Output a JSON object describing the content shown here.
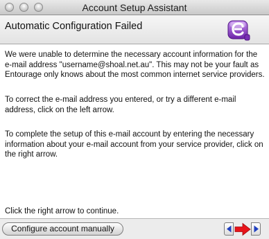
{
  "window": {
    "title": "Account Setup Assistant"
  },
  "header": {
    "title": "Automatic Configuration Failed",
    "logo_icon": "entourage-logo-icon"
  },
  "content": {
    "paragraph1": "We were unable to determine the necessary account information for the e-mail address \"username@shoal.net.au\". This may not be your fault as Entourage only knows about the most common internet service providers.",
    "paragraph2": "To correct the e-mail address you entered, or try a different e-mail address, click on the left arrow.",
    "paragraph3": "To complete the setup of this e-mail account by entering the necessary information about your e-mail account from your service provider, click on the right arrow.",
    "instruction": "Click the right arrow to continue."
  },
  "footer": {
    "manual_button_label": "Configure account manually",
    "prev_icon": "arrow-left-icon",
    "next_icon": "arrow-right-icon",
    "hint_icon": "red-arrow-right-icon"
  },
  "colors": {
    "hint_arrow": "#e8141a",
    "nav_arrow": "#1f3fbf",
    "logo_purple": "#8a3fc0"
  }
}
